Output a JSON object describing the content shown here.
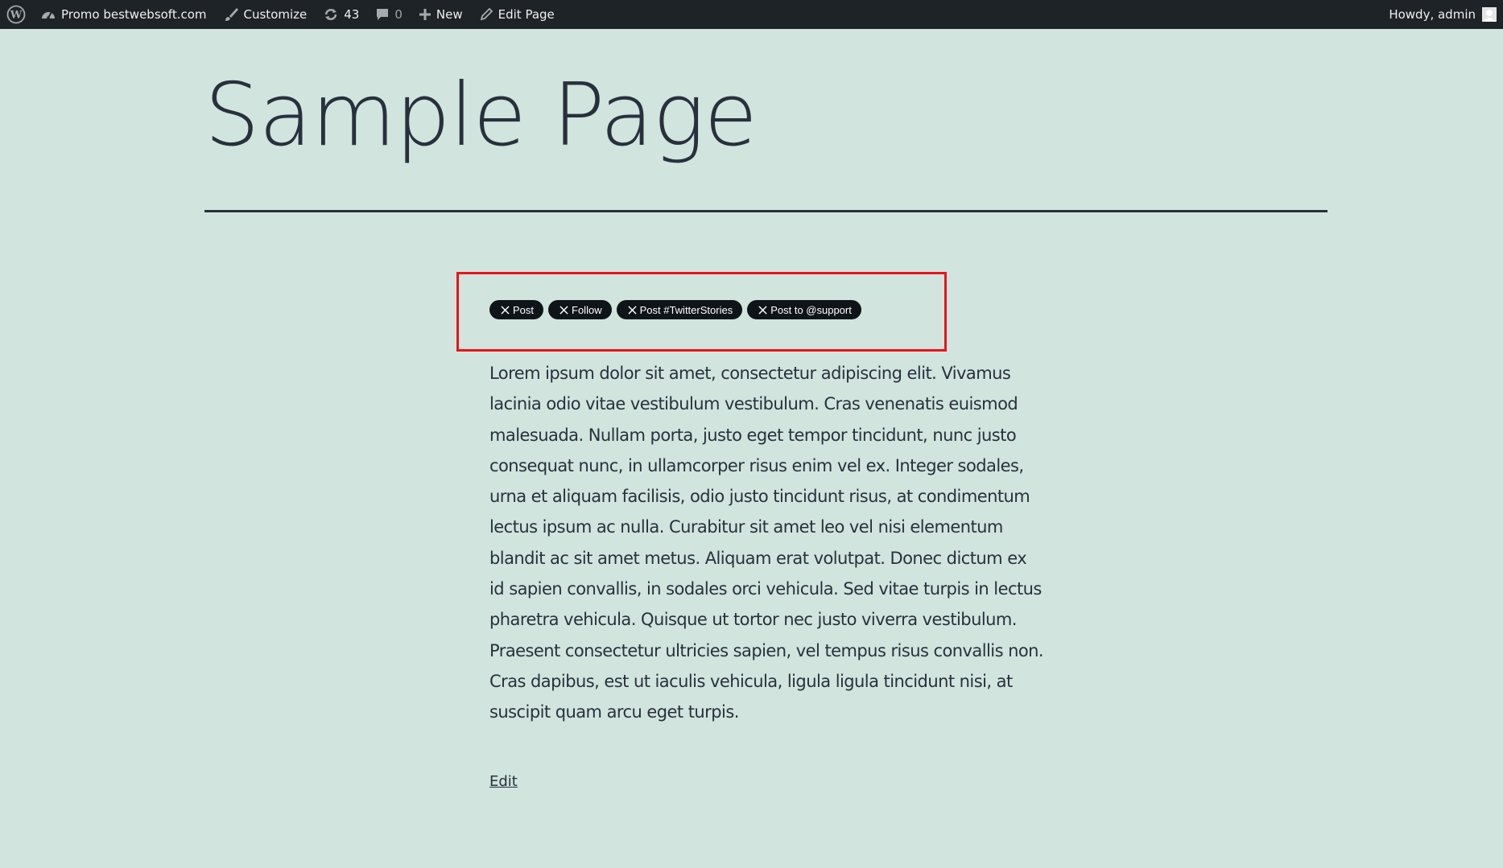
{
  "admin_bar": {
    "site_name": "Promo bestwebsoft.com",
    "customize": "Customize",
    "updates_count": "43",
    "comments_count": "0",
    "new": "New",
    "edit_page": "Edit Page",
    "greeting": "Howdy, admin"
  },
  "page": {
    "title": "Sample Page",
    "buttons": [
      "Post",
      "Follow",
      "Post #TwitterStories",
      "Post to @support"
    ],
    "body": "Lorem ipsum dolor sit amet, consectetur adipiscing elit. Vivamus lacinia odio vitae vestibulum vestibulum. Cras venenatis euismod malesuada. Nullam porta, justo eget tempor tincidunt, nunc justo consequat nunc, in ullamcorper risus enim vel ex. Integer sodales, urna et aliquam facilisis, odio justo tincidunt risus, at condimentum lectus ipsum ac nulla. Curabitur sit amet leo vel nisi elementum blandit ac sit amet metus. Aliquam erat volutpat. Donec dictum ex id sapien convallis, in sodales orci vehicula. Sed vitae turpis in lectus pharetra vehicula. Quisque ut tortor nec justo viverra vestibulum. Praesent consectetur ultricies sapien, vel tempus risus convallis non. Cras dapibus, est ut iaculis vehicula, ligula ligula tincidunt nisi, at suscipit quam arcu eget turpis.",
    "edit_link": "Edit"
  },
  "colors": {
    "background": "#d1e4dd",
    "admin_bar": "#1d2327",
    "text": "#28303d",
    "highlight": "#e8141b",
    "x_button": "#0f1419"
  },
  "icons": [
    "wordpress-logo-icon",
    "dashboard-icon",
    "brush-icon",
    "updates-icon",
    "comment-icon",
    "plus-icon",
    "pencil-icon",
    "x-logo-icon",
    "user-avatar-icon"
  ]
}
